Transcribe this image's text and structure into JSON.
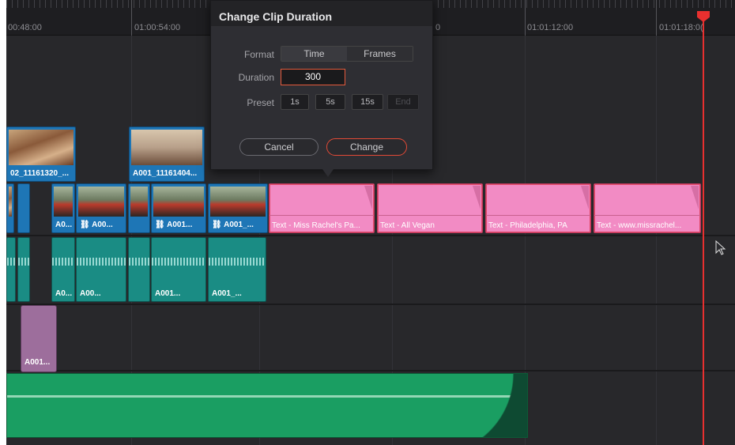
{
  "ruler": {
    "timecodes": [
      "00:48:00",
      "01:00:54:00",
      "0",
      "01:01:12:00",
      "01:01:18:0("
    ]
  },
  "video_clips": [
    {
      "label": "02_11161320_..."
    },
    {
      "label": "A001_11161404..."
    },
    {
      "label": "A0..."
    },
    {
      "label": "A00..."
    },
    {
      "label": "A001..."
    },
    {
      "label": "A001_..."
    }
  ],
  "title_clips": [
    {
      "label": "Text - Miss Rachel's Pa..."
    },
    {
      "label": "Text - All Vegan"
    },
    {
      "label": "Text - Philadelphia, PA"
    },
    {
      "label": "Text - www.missrachel..."
    }
  ],
  "audio_clips": [
    {
      "label": "A0..."
    },
    {
      "label": "A00..."
    },
    {
      "label": "A001..."
    },
    {
      "label": "A001_..."
    }
  ],
  "magenta_clip": {
    "label": "A001..."
  },
  "dialog": {
    "title": "Change Clip Duration",
    "format_label": "Format",
    "format_options": [
      "Time",
      "Frames"
    ],
    "duration_label": "Duration",
    "duration_value": "300",
    "preset_label": "Preset",
    "preset_options": [
      "1s",
      "5s",
      "15s",
      "End"
    ],
    "cancel_label": "Cancel",
    "change_label": "Change"
  },
  "colors": {
    "playhead": "#e8302f",
    "video_clip": "#1e76b6",
    "title_clip": "#f28bc4",
    "audio_clip": "#1a8c84",
    "music_clip": "#1a9e62"
  },
  "icons": [
    "link-icon",
    "mouse-pointer-icon",
    "playhead-marker-icon"
  ]
}
